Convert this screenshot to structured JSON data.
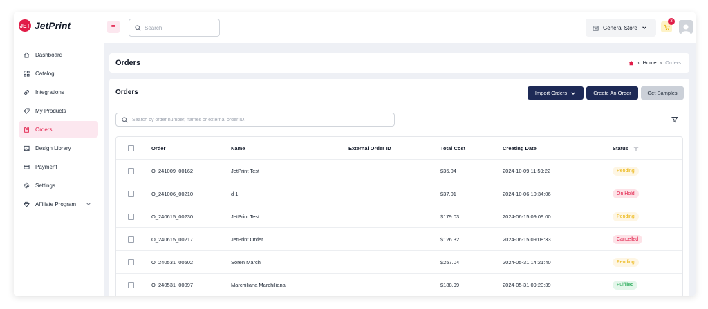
{
  "brand": {
    "logo_mark": "JET",
    "name": "JetPrint"
  },
  "topbar": {
    "search_placeholder": "Search",
    "store": "General Store",
    "cart_count": "3"
  },
  "sidebar": {
    "items": [
      {
        "label": "Dashboard",
        "icon": "home-icon",
        "active": false
      },
      {
        "label": "Catalog",
        "icon": "grid-icon",
        "active": false
      },
      {
        "label": "Integrations",
        "icon": "link-icon",
        "active": false
      },
      {
        "label": "My Products",
        "icon": "tag-icon",
        "active": false
      },
      {
        "label": "Orders",
        "icon": "clipboard-icon",
        "active": true
      },
      {
        "label": "Design Library",
        "icon": "image-icon",
        "active": false
      },
      {
        "label": "Payment",
        "icon": "card-icon",
        "active": false
      },
      {
        "label": "Settings",
        "icon": "gear-icon",
        "active": false
      },
      {
        "label": "Affiliate Program",
        "icon": "diamond-icon",
        "active": false
      }
    ]
  },
  "header": {
    "title": "Orders",
    "breadcrumb_home": "Home",
    "breadcrumb_current": "Orders"
  },
  "content": {
    "title": "Orders",
    "import_label": "Import Orders",
    "create_label": "Create An Order",
    "samples_label": "Get Samples",
    "search_placeholder": "Search by order number, names or external order ID."
  },
  "table": {
    "columns": [
      "Order",
      "Name",
      "External Order ID",
      "Total Cost",
      "Creating Date",
      "Status"
    ],
    "rows": [
      {
        "order": "O_241009_00162",
        "name": "JetPrint Test",
        "external": "",
        "cost": "$35.04",
        "date": "2024-10-09 11:59:22",
        "status": "Pending"
      },
      {
        "order": "O_241006_00210",
        "name": "d 1",
        "external": "",
        "cost": "$37.01",
        "date": "2024-10-06 10:34:06",
        "status": "On Hold"
      },
      {
        "order": "O_240615_00230",
        "name": "JetPrint Test",
        "external": "",
        "cost": "$179.03",
        "date": "2024-06-15 09:09:00",
        "status": "Pending"
      },
      {
        "order": "O_240615_00217",
        "name": "JetPrint Order",
        "external": "",
        "cost": "$126.32",
        "date": "2024-06-15 09:08:33",
        "status": "Cancelled"
      },
      {
        "order": "O_240531_00502",
        "name": "Soren March",
        "external": "",
        "cost": "$257.04",
        "date": "2024-05-31 14:21:40",
        "status": "Pending"
      },
      {
        "order": "O_240531_00097",
        "name": "Marchiliana Marchiliana",
        "external": "",
        "cost": "$188.99",
        "date": "2024-05-31 09:20:39",
        "status": "Fulfilled"
      }
    ]
  },
  "colors": {
    "accent": "#e11d48",
    "primary_button": "#1e2a56",
    "pending": "#eab308",
    "hold": "#e11d48",
    "fulfilled": "#16a34a"
  }
}
